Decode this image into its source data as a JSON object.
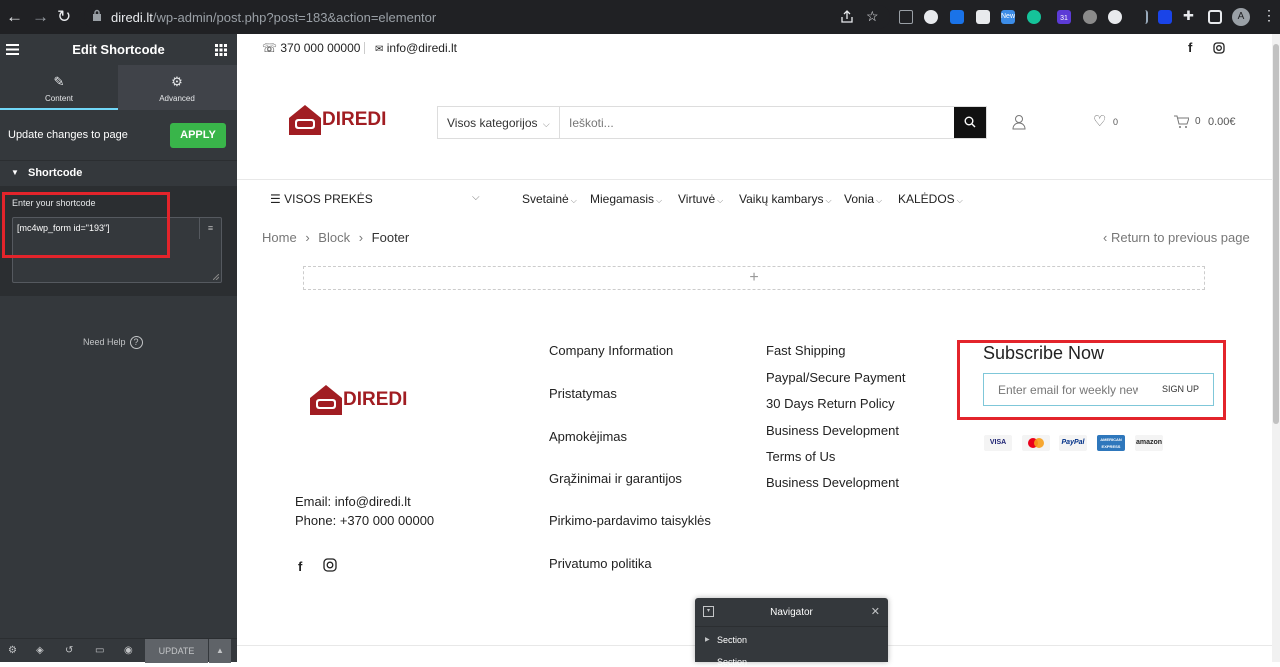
{
  "browser": {
    "url_host": "diredi.lt",
    "url_path": "/wp-admin/post.php?post=183&action=elementor",
    "new_badge": "New",
    "calendar_badge": "31",
    "profile_initial": "A"
  },
  "panel": {
    "title": "Edit Shortcode",
    "tabs": [
      {
        "label": "Content"
      },
      {
        "label": "Advanced"
      }
    ],
    "update_label": "Update changes to page",
    "apply_label": "APPLY",
    "section_label": "Shortcode",
    "shortcode_label": "Enter your shortcode",
    "shortcode_value": "[mc4wp_form id=\"193\"]",
    "need_help": "Need Help",
    "update_button": "UPDATE"
  },
  "site": {
    "phone_top": "370 000 00000",
    "email_top": "info@diredi.lt",
    "logo_text": "DIREDI",
    "category_select": "Visos kategorijos",
    "search_placeholder": "Ieškoti...",
    "wishlist_count": "0",
    "cart_count": "0",
    "cart_total": "0.00€",
    "menu_all": "VISOS PREKĖS",
    "menu": [
      "Svetainė",
      "Miegamasis",
      "Virtuvė",
      "Vaikų kambarys",
      "Vonia",
      "KALĖDOS"
    ],
    "breadcrumb": [
      "Home",
      "Block",
      "Footer"
    ],
    "return_link": "Return to previous page",
    "add_section": "+"
  },
  "footer": {
    "email": "Email: info@diredi.lt",
    "phone": "Phone: +370 000 00000",
    "col1": [
      "Company Information",
      "Pristatymas",
      "Apmokėjimas",
      "Grąžinimai ir garantijos",
      "Pirkimo-pardavimo taisyklės",
      "Privatumo politika"
    ],
    "col2": [
      "Fast Shipping",
      "Paypal/Secure Payment",
      "30 Days Return Policy",
      "Business Development",
      "Terms of Us",
      "Business Development"
    ],
    "subscribe_title": "Subscribe Now",
    "subscribe_placeholder": "Enter email for weekly newsletter",
    "signup": "SIGN UP",
    "cards": [
      "VISA",
      "",
      "PayPal",
      "AMERICAN EXPRESS",
      "amazon"
    ]
  },
  "navigator": {
    "title": "Navigator",
    "items": [
      "Section",
      "Section"
    ]
  },
  "colors": {
    "brand": "#a11d22",
    "panel_bg": "#34383c",
    "apply_green": "#39b54a",
    "highlight_red": "#e3242b"
  }
}
